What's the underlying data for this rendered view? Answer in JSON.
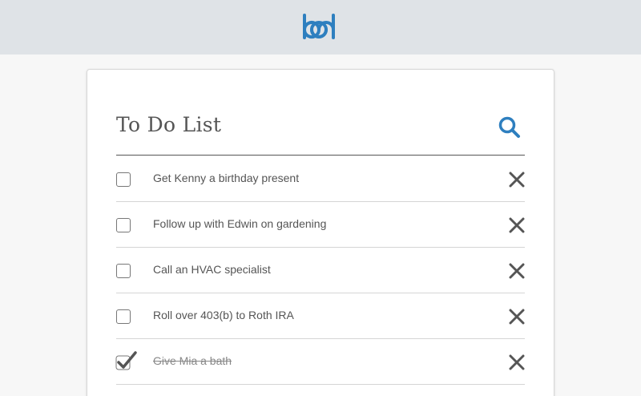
{
  "header": {
    "logo_icon": "bd-logo",
    "accent": "#2e7fbf"
  },
  "card": {
    "title": "To Do List",
    "search_icon": "search-icon"
  },
  "todos": [
    {
      "label": "Get Kenny a birthday present",
      "done": false
    },
    {
      "label": "Follow up with Edwin on gardening",
      "done": false
    },
    {
      "label": "Call an HVAC specialist",
      "done": false
    },
    {
      "label": "Roll over 403(b) to Roth IRA",
      "done": false
    },
    {
      "label": "Give Mia a bath",
      "done": true
    }
  ],
  "colors": {
    "topbar": "#dfe3e7",
    "text": "#555555",
    "icon": "#555555"
  }
}
